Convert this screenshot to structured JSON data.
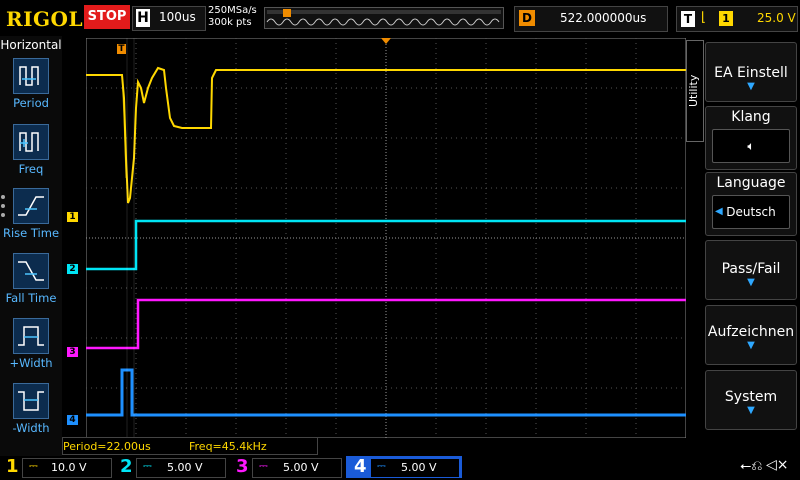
{
  "brand": "RIGOL",
  "run_state": "STOP",
  "timebase": {
    "label": "H",
    "value": "100us"
  },
  "sample": {
    "rate": "250MSa/s",
    "points": "300k pts"
  },
  "trigger_delay": {
    "label": "D",
    "value": "522.000000us"
  },
  "trigger": {
    "label": "T",
    "source": "1",
    "level": "25.0 V"
  },
  "left_menu": {
    "title": "Horizontal",
    "items": [
      {
        "label": "Period",
        "icon": "period-icon"
      },
      {
        "label": "Freq",
        "icon": "freq-icon"
      },
      {
        "label": "Rise Time",
        "icon": "rise-time-icon"
      },
      {
        "label": "Fall Time",
        "icon": "fall-time-icon"
      },
      {
        "label": "+Width",
        "icon": "pos-width-icon"
      },
      {
        "label": "-Width",
        "icon": "neg-width-icon"
      }
    ]
  },
  "right_menu": {
    "tab": "Utility",
    "items": [
      {
        "label": "EA Einstell"
      },
      {
        "label": "Klang",
        "sub": "speaker"
      },
      {
        "label": "Language",
        "sub": "Deutsch"
      },
      {
        "label": "Pass/Fail"
      },
      {
        "label": "Aufzeichnen"
      },
      {
        "label": "System"
      }
    ]
  },
  "measurements": {
    "period": "Period=22.00us",
    "freq": "Freq=45.4kHz"
  },
  "channels": [
    {
      "num": "1",
      "scale": "10.0 V",
      "color": "#ffd800"
    },
    {
      "num": "2",
      "scale": "5.00 V",
      "color": "#00e5f5"
    },
    {
      "num": "3",
      "scale": "5.00 V",
      "color": "#ff18ff"
    },
    {
      "num": "4",
      "scale": "5.00 V",
      "color": "#1e90ff"
    }
  ],
  "markers": [
    "1",
    "2",
    "3",
    "4"
  ],
  "colors": {
    "ch1": "#ffd800",
    "ch2": "#00e5f5",
    "ch3": "#ff18ff",
    "ch4": "#1e90ff",
    "accent": "#2ea8ff",
    "stop": "#e31b1b"
  }
}
